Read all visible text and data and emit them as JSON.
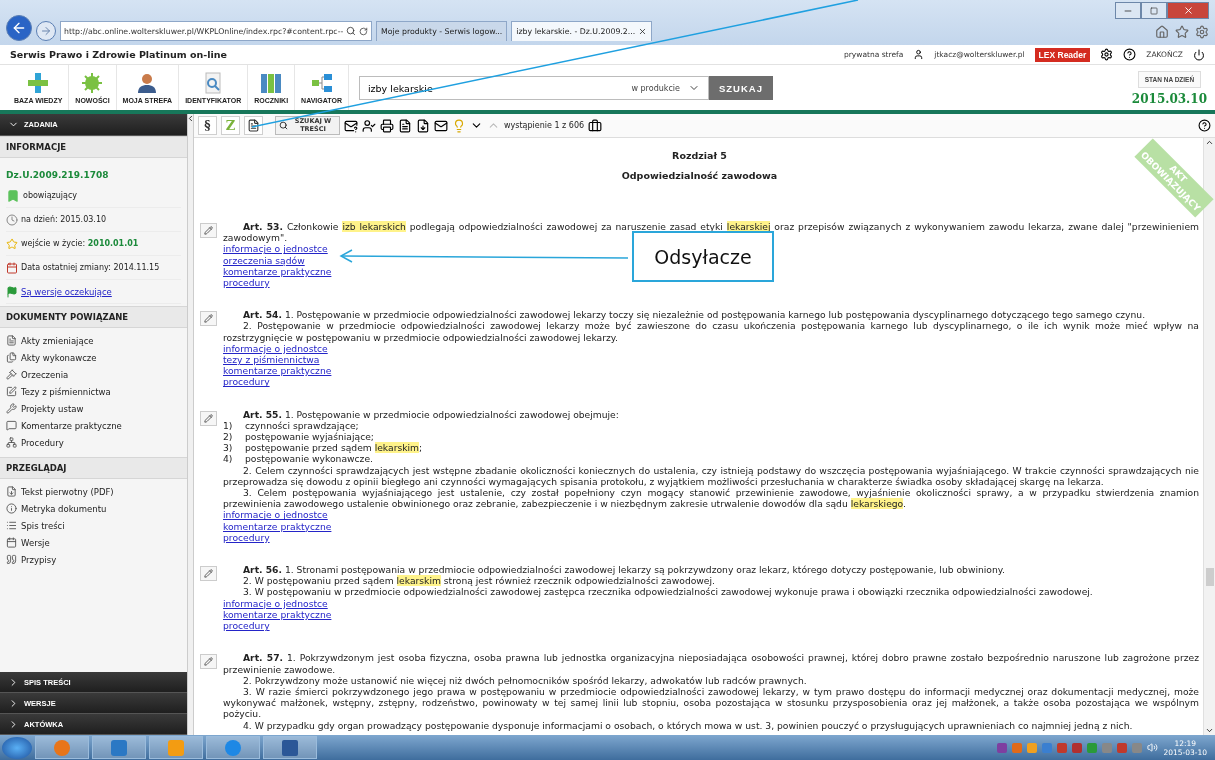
{
  "browser": {
    "address": "http://abc.online.wolterskluwer.pl/WKPLOnline/index.rpc?#content.rpc--",
    "tabs": [
      {
        "label": "Moje produkty - Serwis logow...",
        "selected": false
      },
      {
        "label": "izby lekarskie. - Dz.U.2009.2...",
        "selected": true
      }
    ]
  },
  "header": {
    "title": "Serwis Prawo i Zdrowie Platinum on-line",
    "private_zone": "prywatna strefa",
    "user": "jtkacz@wolterskluwer.pl",
    "reader": "LEX Reader",
    "logout": "ZAKOŃCZ"
  },
  "nav": [
    "BAZA WIEDZY",
    "NOWOŚCI",
    "MOJA STREFA",
    "IDENTYFIKATOR",
    "ROCZNIKI",
    "NAVIGATOR"
  ],
  "search": {
    "value": "izby lekarskie",
    "scope": "w produkcie",
    "button": "SZUKAJ"
  },
  "state_date": {
    "label": "STAN NA DZIEŃ",
    "value": "2015.03.10"
  },
  "sidebar": {
    "tasks": "ZADANIA",
    "info_title": "INFORMACJE",
    "act_id": "Dz.U.2009.219.1708",
    "status": "obowiązujący",
    "rows": [
      {
        "label": "na dzień: ",
        "value": "2015.03.10",
        "emphasis": false
      },
      {
        "label": "wejście w życie: ",
        "value": "2010.01.01",
        "emphasis": true
      },
      {
        "label": "Data ostatniej zmiany: ",
        "value": "2014.11.15",
        "emphasis": false
      }
    ],
    "pending_link": "Są wersje oczekujące",
    "sections": [
      {
        "title": "DOKUMENTY POWIĄZANE",
        "items": [
          "Akty zmieniające",
          "Akty wykonawcze",
          "Orzeczenia",
          "Tezy z piśmiennictwa",
          "Projekty ustaw",
          "Komentarze praktyczne",
          "Procedury"
        ]
      },
      {
        "title": "PRZEGLĄDAJ",
        "items": [
          "Tekst pierwotny (PDF)",
          "Metryka dokumentu",
          "Spis treści",
          "Wersje",
          "Przypisy"
        ]
      }
    ],
    "panels": [
      "SPIS TREŚCI",
      "WERSJE",
      "AKTÓWKA"
    ]
  },
  "toolbar": {
    "section": "§",
    "z": "Z",
    "search_in_text": "SZUKAJ W TREŚCI",
    "occurrence": "wystąpienie 1 z 606"
  },
  "document": {
    "chapter": "Rozdział 5",
    "chapter_title": "Odpowiedzialność zawodowa",
    "badge": "AKT OBOWIĄZUJĄCY",
    "articles": [
      {
        "paragraphs": [
          {
            "kind": "lead",
            "segments": [
              {
                "text": "**Art. 53.** Członkowie ",
                "highlight": false
              },
              {
                "text": "izb ",
                "highlight": true
              },
              {
                "text": "lekarskich",
                "highlight": true
              },
              {
                "text": " podlegają odpowiedzialności zawodowej za naruszenie zasad etyki ",
                "highlight": false
              },
              {
                "text": "lekarskiej",
                "highlight": true
              },
              {
                "text": " oraz przepisów związanych z wykonywaniem zawodu lekarza, zwane dalej \"przewinieniem zawodowym\".",
                "highlight": false
              }
            ]
          }
        ],
        "links": [
          "informacje o jednostce",
          "orzeczenia sądów",
          "komentarze praktyczne",
          "procedury"
        ]
      },
      {
        "paragraphs": [
          {
            "kind": "lead",
            "segments": [
              {
                "text": "**Art. 54.** 1. Postępowanie w przedmiocie odpowiedzialności zawodowej lekarzy toczy się niezależnie od postępowania karnego lub postępowania dyscyplinarnego dotyczącego tego samego czynu.",
                "highlight": false
              }
            ]
          },
          {
            "kind": "section",
            "segments": [
              {
                "text": "2. Postępowanie w przedmiocie odpowiedzialności zawodowej lekarzy może być zawieszone do czasu ukończenia postępowania karnego lub dyscyplinarnego, o ile ich wynik może mieć wpływ na rozstrzygnięcie w postępowaniu w przedmiocie odpowiedzialności zawodowej lekarzy.",
                "highlight": false
              }
            ]
          }
        ],
        "links": [
          "informacje o jednostce",
          "tezy z piśmiennictwa",
          "komentarze praktyczne",
          "procedury"
        ]
      },
      {
        "paragraphs": [
          {
            "kind": "lead",
            "segments": [
              {
                "text": "**Art. 55.** 1. Postępowanie w przedmiocie odpowiedzialności zawodowej obejmuje:",
                "highlight": false
              }
            ]
          },
          {
            "kind": "point",
            "number": "1)",
            "segments": [
              {
                "text": "czynności sprawdzające;",
                "highlight": false
              }
            ]
          },
          {
            "kind": "point",
            "number": "2)",
            "segments": [
              {
                "text": "postępowanie wyjaśniające;",
                "highlight": false
              }
            ]
          },
          {
            "kind": "point",
            "number": "3)",
            "segments": [
              {
                "text": "postępowanie przed sądem ",
                "highlight": false
              },
              {
                "text": "lekarskim",
                "highlight": true
              },
              {
                "text": ";",
                "highlight": false
              }
            ]
          },
          {
            "kind": "point",
            "number": "4)",
            "segments": [
              {
                "text": "postępowanie wykonawcze.",
                "highlight": false
              }
            ]
          },
          {
            "kind": "section",
            "segments": [
              {
                "text": "2. Celem czynności sprawdzających jest wstępne zbadanie okoliczności koniecznych do ustalenia, czy istnieją podstawy do wszczęcia postępowania wyjaśniającego. W trakcie czynności sprawdzających nie przeprowadza się dowodu z opinii biegłego ani czynności wymagających spisania protokołu, z wyjątkiem możliwości przesłuchania w charakterze świadka osoby składającej skargę na lekarza.",
                "highlight": false
              }
            ]
          },
          {
            "kind": "section",
            "segments": [
              {
                "text": "3. Celem postępowania wyjaśniającego jest ustalenie, czy został popełniony czyn mogący stanowić przewinienie zawodowe, wyjaśnienie okoliczności sprawy, a w przypadku stwierdzenia znamion przewinienia zawodowego ustalenie obwinionego oraz zebranie, zabezpieczenie i w niezbędnym zakresie utrwalenie dowodów dla sądu ",
                "highlight": false
              },
              {
                "text": "lekarskiego",
                "highlight": true
              },
              {
                "text": ".",
                "highlight": false
              }
            ]
          }
        ],
        "links": [
          "informacje o jednostce",
          "komentarze praktyczne",
          "procedury"
        ]
      },
      {
        "paragraphs": [
          {
            "kind": "lead",
            "segments": [
              {
                "text": "**Art. 56.** 1. Stronami postępowania w przedmiocie odpowiedzialności zawodowej lekarzy są pokrzywdzony oraz lekarz, którego dotyczy postępowanie, lub obwiniony.",
                "highlight": false
              }
            ]
          },
          {
            "kind": "section",
            "segments": [
              {
                "text": "2. W postępowaniu przed sądem ",
                "highlight": false
              },
              {
                "text": "lekarskim",
                "highlight": true
              },
              {
                "text": " stroną jest również rzecznik odpowiedzialności zawodowej.",
                "highlight": false
              }
            ]
          },
          {
            "kind": "section",
            "segments": [
              {
                "text": "3. W postępowaniu w przedmiocie odpowiedzialności zawodowej zastępca rzecznika odpowiedzialności zawodowej wykonuje prawa i obowiązki rzecznika odpowiedzialności zawodowej.",
                "highlight": false
              }
            ]
          }
        ],
        "links": [
          "informacje o jednostce",
          "komentarze praktyczne",
          "procedury"
        ]
      },
      {
        "paragraphs": [
          {
            "kind": "lead",
            "segments": [
              {
                "text": "**Art. 57.** 1. Pokrzywdzonym jest osoba fizyczna, osoba prawna lub jednostka organizacyjna nieposiadająca osobowości prawnej, której dobro prawne zostało bezpośrednio naruszone lub zagrożone przez przewinienie zawodowe.",
                "highlight": false
              }
            ]
          },
          {
            "kind": "section",
            "segments": [
              {
                "text": "2. Pokrzywdzony może ustanowić nie więcej niż dwóch pełnomocników spośród lekarzy, adwokatów lub radców prawnych.",
                "highlight": false
              }
            ]
          },
          {
            "kind": "section",
            "segments": [
              {
                "text": "3. W razie śmierci pokrzywdzonego jego prawa w postępowaniu w przedmiocie odpowiedzialności zawodowej lekarzy, w tym prawo dostępu do informacji medycznej oraz dokumentacji medycznej, może wykonywać małżonek, wstępny, zstępny, rodzeństwo, powinowaty w tej samej linii lub stopniu, osoba pozostająca w stosunku przysposobienia oraz jej małżonek, a także osoba pozostająca we wspólnym pożyciu.",
                "highlight": false
              }
            ]
          },
          {
            "kind": "section",
            "segments": [
              {
                "text": "4. W przypadku gdy organ prowadzący postępowanie dysponuje informacjami o osobach, o których mowa w ust. 3, powinien pouczyć o przysługujących uprawnieniach co najmniej jedną z nich.",
                "highlight": false
              }
            ]
          }
        ]
      }
    ]
  },
  "annotation": {
    "label": "Odsyłacze"
  },
  "taskbar": {
    "time": "12:19",
    "date": "2015-03-10"
  }
}
